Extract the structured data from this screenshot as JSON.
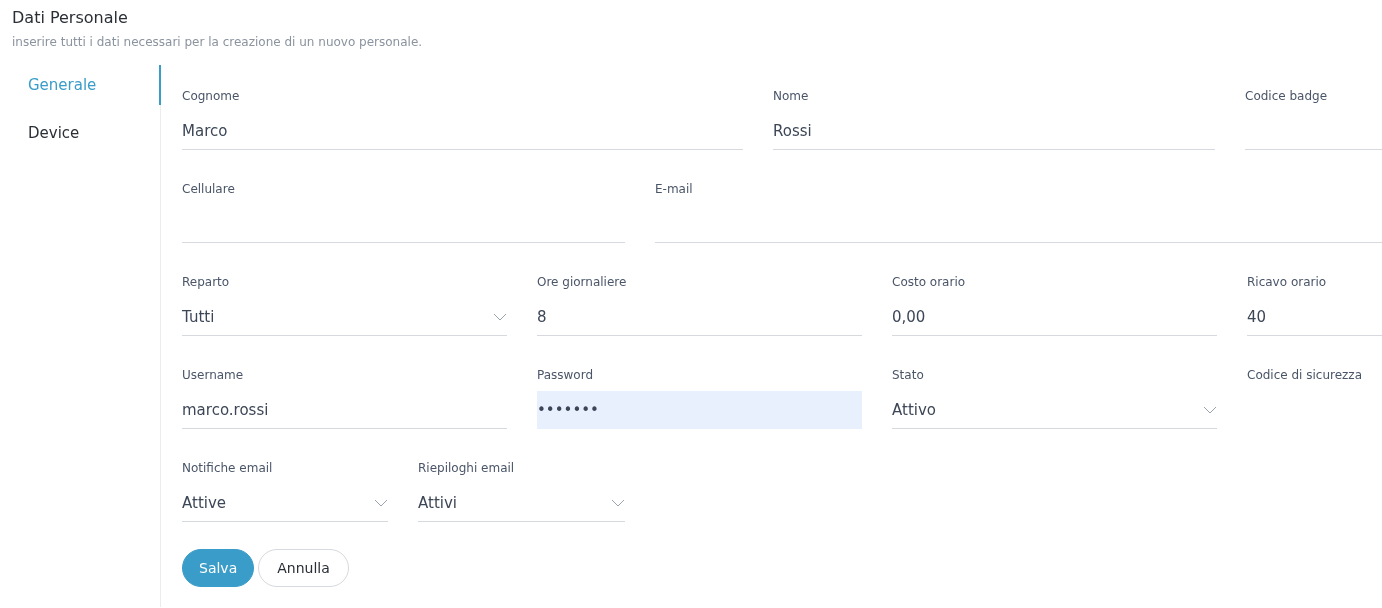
{
  "header": {
    "title": "Dati Personale",
    "subtitle": "inserire tutti i dati necessari per la creazione di un nuovo personale."
  },
  "sidebar": {
    "items": [
      {
        "label": "Generale",
        "selected": true
      },
      {
        "label": "Device",
        "selected": false
      }
    ]
  },
  "form": {
    "lines": [
      {
        "fields": [
          {
            "kind": "text",
            "label": "Cognome",
            "value": "Marco"
          },
          {
            "kind": "text",
            "label": "Nome",
            "value": "Rossi"
          },
          {
            "kind": "text",
            "label": "Codice badge"
          }
        ]
      },
      {
        "fields": [
          {
            "kind": "text",
            "label": "Cellulare"
          },
          {
            "kind": "text",
            "label": "E-mail"
          }
        ]
      },
      {
        "fields": [
          {
            "kind": "select",
            "label": "Reparto",
            "value": "Tutti"
          },
          {
            "kind": "text",
            "label": "Ore giornaliere",
            "value": "8"
          },
          {
            "kind": "text",
            "label": "Costo orario",
            "value": "0,00"
          },
          {
            "kind": "text",
            "label": "Ricavo orario",
            "value": "40"
          }
        ]
      },
      {
        "fields": [
          {
            "kind": "text",
            "label": "Username",
            "value": "marco.rossi"
          },
          {
            "kind": "text",
            "label": "Password",
            "value": "•••••••",
            "autofilled": true
          },
          {
            "kind": "select",
            "label": "Stato",
            "value": "Attivo"
          },
          {
            "kind": "label",
            "label": "Codice di sicurezza"
          }
        ]
      },
      {
        "fields": [
          {
            "kind": "select",
            "label": "Notifiche email",
            "value": "Attive"
          },
          {
            "kind": "select",
            "label": "Riepiloghi email",
            "value": "Attivi"
          }
        ]
      }
    ]
  },
  "buttons": [
    {
      "label": "Salva",
      "primary": true
    },
    {
      "label": "Annulla",
      "primary": false
    }
  ]
}
